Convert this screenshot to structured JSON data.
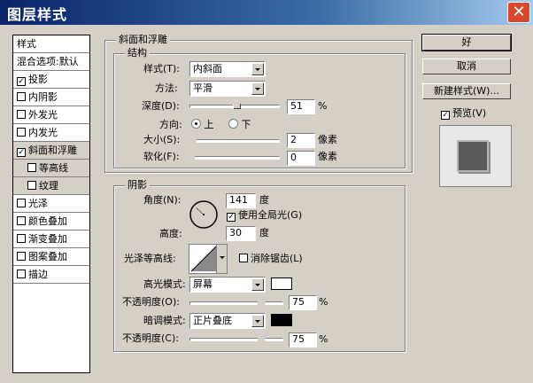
{
  "window": {
    "title": "图层样式",
    "close_icon": "close-icon"
  },
  "list": {
    "items": [
      {
        "label": "样式",
        "checkbox": false,
        "checked": false,
        "kind": "head"
      },
      {
        "label": "混合选项:默认",
        "checkbox": false,
        "checked": false,
        "kind": "head"
      },
      {
        "label": "投影",
        "checkbox": true,
        "checked": true,
        "kind": "item"
      },
      {
        "label": "内阴影",
        "checkbox": true,
        "checked": false,
        "kind": "item"
      },
      {
        "label": "外发光",
        "checkbox": true,
        "checked": false,
        "kind": "item"
      },
      {
        "label": "内发光",
        "checkbox": true,
        "checked": false,
        "kind": "item"
      },
      {
        "label": "斜面和浮雕",
        "checkbox": true,
        "checked": true,
        "kind": "sel"
      },
      {
        "label": "等高线",
        "checkbox": true,
        "checked": false,
        "kind": "sub"
      },
      {
        "label": "纹理",
        "checkbox": true,
        "checked": false,
        "kind": "sub"
      },
      {
        "label": "光泽",
        "checkbox": true,
        "checked": false,
        "kind": "item"
      },
      {
        "label": "颜色叠加",
        "checkbox": true,
        "checked": false,
        "kind": "item"
      },
      {
        "label": "渐变叠加",
        "checkbox": true,
        "checked": false,
        "kind": "item"
      },
      {
        "label": "图案叠加",
        "checkbox": true,
        "checked": false,
        "kind": "item"
      },
      {
        "label": "描边",
        "checkbox": true,
        "checked": false,
        "kind": "item"
      }
    ]
  },
  "bevel": {
    "group_label": "斜面和浮雕",
    "structure_label": "结构",
    "style_label": "样式(T):",
    "style_value": "内斜面",
    "method_label": "方法:",
    "method_value": "平滑",
    "depth_label": "深度(D):",
    "depth_value": "51",
    "depth_unit": "%",
    "depth_level": 0.51,
    "direction_label": "方向:",
    "dir_up": "上",
    "dir_down": "下",
    "size_label": "大小(S):",
    "size_value": "2",
    "size_unit": "像素",
    "soften_label": "软化(F):",
    "soften_value": "0",
    "soften_unit": "像素"
  },
  "shading": {
    "group_label": "阴影",
    "angle_label": "角度(N):",
    "angle_value": "141",
    "angle_unit": "度",
    "global_light_label": "使用全局光(G)",
    "global_light_checked": true,
    "altitude_label": "高度:",
    "altitude_value": "30",
    "altitude_unit": "度",
    "gloss_label": "光泽等高线:",
    "antialias_label": "消除锯齿(L)",
    "antialias_checked": false,
    "highlight_label": "高光模式:",
    "highlight_mode": "屏幕",
    "highlight_color": "#ffffff",
    "opacity1_label": "不透明度(O):",
    "opacity1_value": "75",
    "opacity1_unit": "%",
    "opacity1_level": 0.75,
    "shadow_label": "暗调模式:",
    "shadow_mode": "正片叠底",
    "shadow_color": "#000000",
    "opacity2_label": "不透明度(C):",
    "opacity2_value": "75",
    "opacity2_unit": "%",
    "opacity2_level": 0.75
  },
  "buttons": {
    "ok": "好",
    "cancel": "取消",
    "new_style": "新建样式(W)...",
    "preview_label": "预览(V)",
    "preview_checked": true
  }
}
